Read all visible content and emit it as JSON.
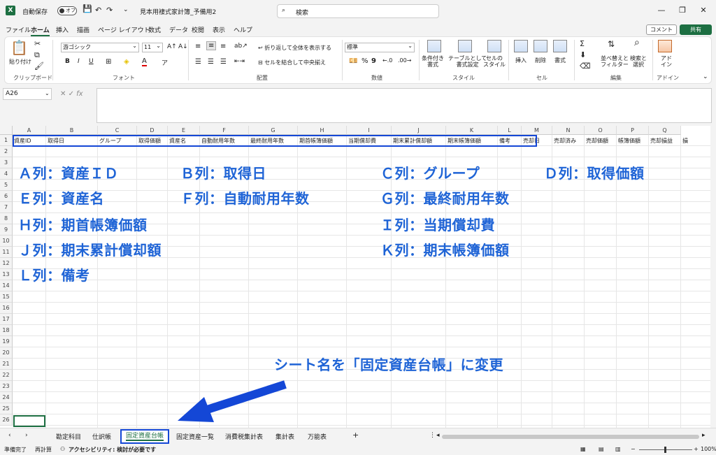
{
  "titlebar": {
    "logo": "X",
    "autosave_label": "自動保存",
    "autosave_state": "オフ",
    "filename": "見本用褄式家計簿_予備用2",
    "search_placeholder": "検索",
    "window_buttons": [
      "—",
      "❐",
      "✕"
    ]
  },
  "menu": {
    "items": [
      "ファイル",
      "ホーム",
      "挿入",
      "描画",
      "ページ レイアウト",
      "数式",
      "データ",
      "校閲",
      "表示",
      "ヘルプ"
    ],
    "active_index": 1,
    "comment_label": "コメント",
    "share_label": "共有"
  },
  "ribbon": {
    "clipboard": {
      "paste_label": "貼り付け",
      "group_label": "クリップボード"
    },
    "font": {
      "font_name": "游ゴシック",
      "font_size": "11",
      "group_label": "フォント"
    },
    "alignment": {
      "wrap_label": "折り返して全体を表示する",
      "merge_label": "セルを結合して中央揃え",
      "group_label": "配置"
    },
    "number": {
      "format": "標準",
      "group_label": "数値"
    },
    "styles": {
      "conditional_label": "条件付き\n書式",
      "table_label": "テーブルとして\n書式設定",
      "cell_style_label": "セルの\nスタイル",
      "group_label": "スタイル"
    },
    "cells": {
      "insert_label": "挿入",
      "delete_label": "削除",
      "format_label": "書式",
      "group_label": "セル"
    },
    "editing": {
      "sort_label": "並べ替えと\nフィルター",
      "find_label": "検索と\n選択",
      "group_label": "編集"
    },
    "addins": {
      "addin_label": "アド\nイン",
      "group_label": "アドイン"
    }
  },
  "formula_bar": {
    "name_box": "A26",
    "fx": "fx",
    "formula": ""
  },
  "grid": {
    "columns": [
      "A",
      "B",
      "C",
      "D",
      "E",
      "F",
      "G",
      "H",
      "I",
      "J",
      "K",
      "L",
      "M",
      "N",
      "O",
      "P",
      "Q"
    ],
    "rows": [
      "1",
      "2",
      "3",
      "4",
      "5",
      "6",
      "7",
      "8",
      "9",
      "10",
      "11",
      "12",
      "13",
      "14",
      "15",
      "16",
      "17",
      "18",
      "19",
      "20",
      "21",
      "22",
      "23",
      "24",
      "25",
      "26"
    ],
    "header_row": [
      "資産ID",
      "取得日",
      "グループ",
      "取得価額",
      "資産名",
      "自動耐用年数",
      "最終耐用年数",
      "期首帳簿価額",
      "当期償却費",
      "期末累計償却額",
      "期末帳簿価額",
      "備考",
      "売却日",
      "売却済み",
      "売却価額",
      "帳簿価額",
      "売却損益",
      "損"
    ]
  },
  "annotations": {
    "notes": [
      "Ａ列：資産ＩＤ",
      "Ｂ列：取得日",
      "Ｃ列：グループ",
      "Ｄ列：取得価額",
      "Ｅ列：資産名",
      "Ｆ列：自動耐用年数",
      "Ｇ列：最終耐用年数",
      "Ｈ列：期首帳簿価額",
      "Ｉ列：当期償却費",
      "Ｊ列：期末累計償却額",
      "Ｋ列：期末帳簿価額",
      "Ｌ列：備考"
    ],
    "callout": "シート名を「固定資産台帳」に変更"
  },
  "sheet_tabs": {
    "tabs": [
      "勘定科目",
      "仕訳帳",
      "固定資産台帳",
      "固定資産一覧",
      "消費税集計表",
      "集計表",
      "万能表"
    ],
    "active_index": 2,
    "add_label": "+"
  },
  "status": {
    "ready": "準備完了",
    "recalc": "再計算",
    "accessibility": "アクセシビリティ: 検討が必要です",
    "zoom": "100%"
  },
  "colors": {
    "accent_green": "#1d6f42",
    "annotation_blue": "#1f64d6",
    "highlight_border": "#1447d6"
  }
}
